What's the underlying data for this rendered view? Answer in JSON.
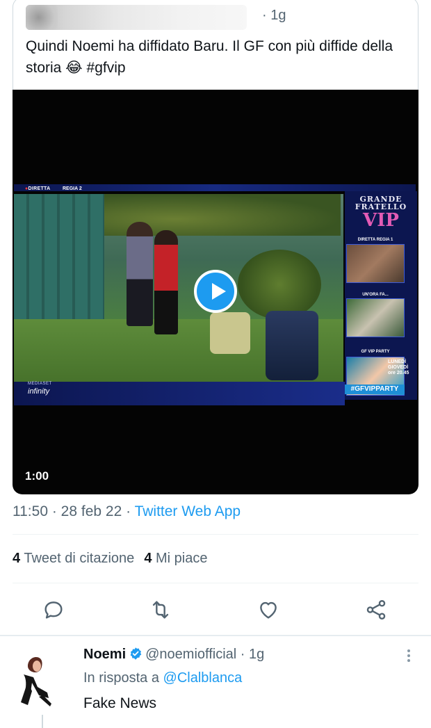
{
  "quoted_tweet": {
    "time": "· 1g",
    "text": "Quindi Noemi ha diffidato Baru. Il GF con più diffide della storia 😂 #gfvip"
  },
  "video": {
    "duration": "1:00",
    "overlay": {
      "diretta": "DIRETTA",
      "regia2": "REGIA 2",
      "logo_line1": "GRANDE",
      "logo_line2": "FRATELLO",
      "logo_vip": "VIP",
      "regia1": "DIRETTA REGIA 1",
      "un_ora_fa": "UN'ORA FA...",
      "gf_vip_party": "GF VIP PARTY",
      "lunedi": "LUNEDÌ",
      "giovedi": "GIOVEDÌ",
      "ore": "ore 20.45",
      "party_tag": "#GFVIPPARTY",
      "mediaset": "MEDIASET",
      "infinity": "infinity"
    }
  },
  "meta": {
    "time": "11:50",
    "date": "28 feb 22",
    "separator": " · ",
    "app": "Twitter Web App"
  },
  "stats": {
    "quotes_count": "4",
    "quotes_label": "Tweet di citazione",
    "likes_count": "4",
    "likes_label": "Mi piace"
  },
  "actions": [
    {
      "icon": "reply-icon"
    },
    {
      "icon": "retweet-icon"
    },
    {
      "icon": "like-icon"
    },
    {
      "icon": "share-icon"
    }
  ],
  "reply": {
    "name": "Noemi",
    "handle": "@noemiofficial",
    "time": "· 1g",
    "reply_prefix": "In risposta a",
    "reply_to_handle": "@Clalblanca",
    "text": "Fake News"
  },
  "colors": {
    "accent": "#1d9bf0",
    "secondary_text": "#536471",
    "primary_text": "#0f1419"
  }
}
